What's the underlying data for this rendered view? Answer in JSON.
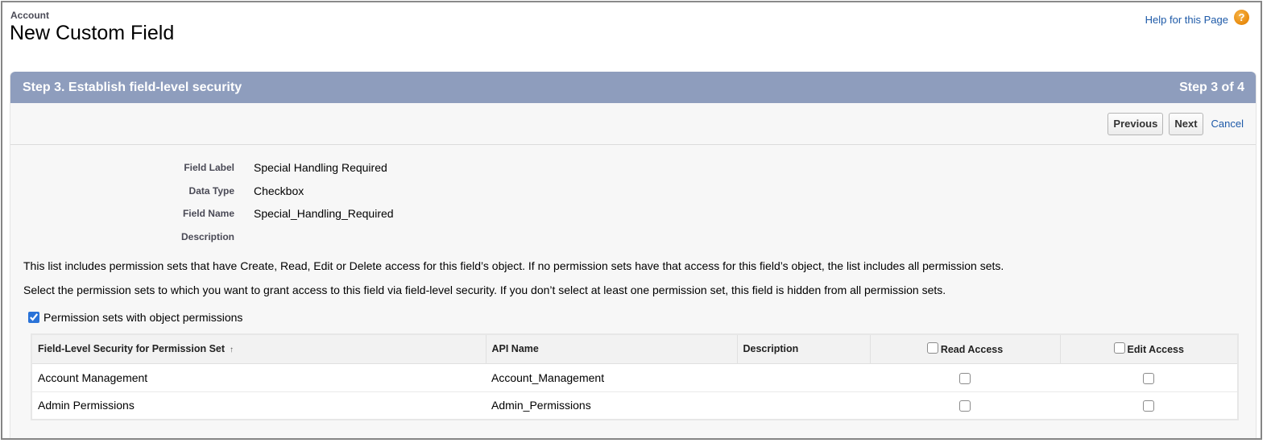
{
  "header": {
    "object_label": "Account",
    "page_title": "New Custom Field",
    "help_link": "Help for this Page",
    "help_icon": "question-mark-icon"
  },
  "step": {
    "title": "Step 3. Establish field-level security",
    "indicator": "Step 3 of 4"
  },
  "buttons": {
    "previous": "Previous",
    "next": "Next",
    "cancel": "Cancel"
  },
  "details": [
    {
      "label": "Field Label",
      "value": "Special Handling Required"
    },
    {
      "label": "Data Type",
      "value": "Checkbox"
    },
    {
      "label": "Field Name",
      "value": "Special_Handling_Required"
    },
    {
      "label": "Description",
      "value": ""
    }
  ],
  "info": {
    "line1": "This list includes permission sets that have Create, Read, Edit or Delete access for this field’s object. If no permission sets have that access for this field’s object, the list includes all permission sets.",
    "line2": "Select the permission sets to which you want to grant access to this field via field-level security. If you don’t select at least one permission set, this field is hidden from all permission sets."
  },
  "filter": {
    "label": "Permission sets with object permissions",
    "checked": true
  },
  "table": {
    "columns": {
      "name": "Field-Level Security for Permission Set",
      "sort_indicator": "↑",
      "api_name": "API Name",
      "description": "Description",
      "read_access": "Read Access",
      "edit_access": "Edit Access"
    },
    "rows": [
      {
        "name": "Account Management",
        "api_name": "Account_Management",
        "description": "",
        "read": false,
        "edit": false
      },
      {
        "name": "Admin Permissions",
        "api_name": "Admin_Permissions",
        "description": "",
        "read": false,
        "edit": false
      }
    ]
  }
}
